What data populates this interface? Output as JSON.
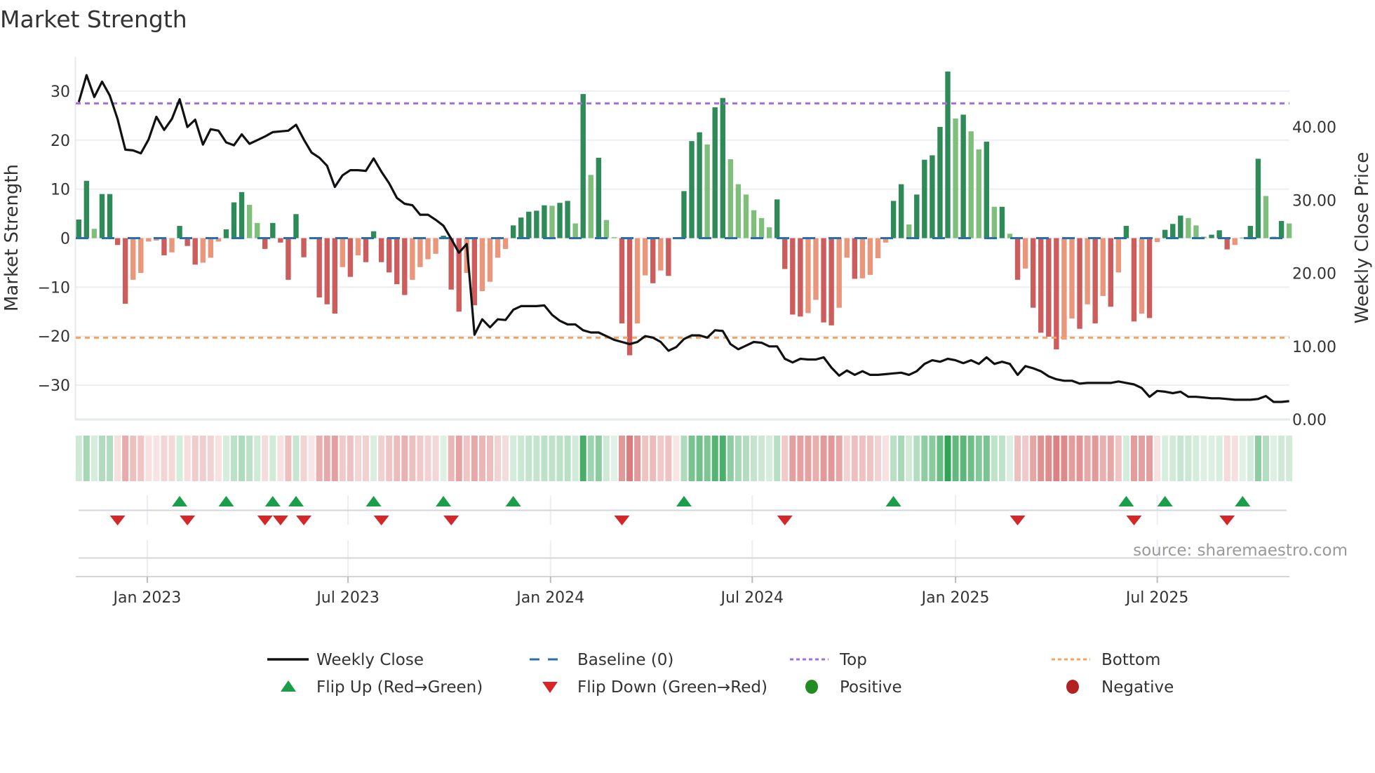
{
  "title": "Market Strength",
  "source": "source: sharemaestro.com",
  "colors": {
    "pos_up": "#2e8b57",
    "pos_down": "#7fbf7b",
    "neg_down": "#cd5c5c",
    "neg_up": "#e9967a",
    "price": "#111111",
    "baseline": "#2a6fa8",
    "top": "#a46ee0",
    "bottom": "#f4a460",
    "flip_up": "#1a9e4a",
    "flip_down": "#d62728",
    "heat_pos": "49,163,84",
    "heat_neg": "205,80,80",
    "legend_positive": "#228b22",
    "legend_negative": "#b22222"
  },
  "legend": {
    "weekly_close": "Weekly Close",
    "baseline": "Baseline (0)",
    "top": "Top",
    "bottom": "Bottom",
    "flip_up": "Flip Up (Red→Green)",
    "flip_down": "Flip Down (Green→Red)",
    "positive": "Positive",
    "negative": "Negative"
  },
  "chart_data": {
    "type": "bar",
    "title": "Market Strength",
    "ylabel": "Market Strength",
    "y2label": "Weekly Close Price",
    "ylim": [
      -37,
      37
    ],
    "y2lim": [
      0,
      49.6
    ],
    "yticks": [
      30,
      20,
      10,
      0,
      -10,
      -20,
      -30
    ],
    "y2ticks": [
      0,
      10,
      20,
      30,
      40
    ],
    "xlabel": "",
    "x_unit": "week index",
    "x_ticks": [
      {
        "label": "Jan 2023",
        "week": 8.83
      },
      {
        "label": "Jul 2023",
        "week": 34.7
      },
      {
        "label": "Jan 2024",
        "week": 60.8
      },
      {
        "label": "Jul 2024",
        "week": 86.8
      },
      {
        "label": "Jan 2025",
        "week": 113.0
      },
      {
        "label": "Jul 2025",
        "week": 139.0
      }
    ],
    "thresholds": {
      "top": 27.5,
      "bottom": -20.3,
      "baseline": 0
    },
    "grid": true,
    "legend_position": "bottom",
    "strength": [
      3.8,
      11.7,
      1.9,
      9.0,
      9.0,
      -1.4,
      -13.4,
      -8.5,
      -7.1,
      -0.7,
      -0.5,
      -3.5,
      -2.9,
      2.5,
      -1.6,
      -5.4,
      -5.0,
      -4.0,
      -0.7,
      1.8,
      7.3,
      9.4,
      6.8,
      3.1,
      -2.2,
      3.1,
      -0.9,
      -8.5,
      4.9,
      -3.9,
      0,
      -12.1,
      -13.5,
      -15.4,
      -5.9,
      -7.9,
      -3.5,
      -4.9,
      1.4,
      -4.9,
      -7.0,
      -9.4,
      -11.6,
      -8.5,
      -5.9,
      -4.3,
      -3.2,
      0.5,
      -10.5,
      -15.0,
      -7.1,
      -13.7,
      -10.8,
      -8.9,
      -4.0,
      -2.2,
      2.6,
      4.2,
      5.4,
      5.6,
      6.7,
      6.6,
      7.2,
      7.6,
      3.0,
      29.4,
      12.9,
      16.4,
      3.7,
      0.2,
      -17.4,
      -23.9,
      -17.4,
      -7.6,
      -9.2,
      -6.6,
      -7.7,
      0,
      9.6,
      19.8,
      21.6,
      19.1,
      26.7,
      28.6,
      16.1,
      11.0,
      8.9,
      5.7,
      4.1,
      2.2,
      7.9,
      -6.3,
      -15.6,
      -16.0,
      -15.3,
      -12.6,
      -17.2,
      -17.8,
      -14.2,
      -4.0,
      -8.3,
      -8.2,
      -7.5,
      -4.1,
      -0.9,
      7.6,
      11.0,
      2.8,
      8.9,
      16.0,
      16.9,
      22.7,
      34.0,
      24.4,
      25.2,
      21.8,
      18.1,
      19.7,
      6.4,
      6.4,
      0.9,
      -8.5,
      -6.2,
      -14.2,
      -19.3,
      -20.1,
      -22.7,
      -20.7,
      -16.4,
      -18.5,
      -13.5,
      -17.4,
      -11.8,
      -14.0,
      -7.0,
      2.5,
      -17.0,
      -15.4,
      -16.3,
      -0.8,
      1.7,
      2.9,
      4.6,
      4.1,
      2.6,
      0.3,
      0.7,
      1.6,
      -2.3,
      -1.4,
      0.1,
      2.5,
      16.2,
      8.6,
      0.3,
      3.5,
      3.0
    ],
    "weekly_close": [
      43.4,
      47.1,
      44.1,
      46.2,
      44.3,
      41.1,
      36.9,
      36.8,
      36.4,
      38.3,
      41.4,
      39.6,
      41.1,
      43.8,
      40.0,
      41.0,
      37.6,
      39.7,
      39.5,
      37.9,
      37.5,
      39.0,
      37.7,
      38.2,
      38.7,
      39.3,
      39.4,
      39.5,
      40.3,
      38.3,
      36.5,
      35.8,
      34.7,
      31.8,
      33.4,
      34.1,
      34.1,
      34.0,
      35.7,
      33.9,
      32.3,
      30.3,
      29.5,
      29.3,
      28.0,
      28.0,
      27.3,
      26.5,
      24.7,
      22.8,
      24.0,
      11.6,
      13.7,
      12.6,
      13.7,
      13.6,
      15.0,
      15.5,
      15.5,
      15.5,
      15.6,
      14.3,
      13.5,
      13.0,
      13.0,
      12.2,
      11.9,
      11.9,
      11.4,
      10.9,
      10.6,
      10.3,
      10.6,
      11.4,
      11.2,
      10.6,
      9.4,
      9.9,
      11.0,
      11.5,
      11.5,
      11.2,
      12.2,
      12.1,
      10.3,
      9.6,
      10.1,
      10.6,
      10.5,
      10.0,
      10.0,
      8.3,
      7.8,
      8.3,
      8.2,
      8.2,
      8.5,
      7.1,
      6.0,
      6.7,
      6.1,
      6.6,
      6.1,
      6.1,
      6.2,
      6.3,
      6.4,
      6.1,
      6.6,
      7.6,
      8.1,
      7.9,
      8.3,
      8.1,
      7.7,
      8.1,
      7.6,
      8.5,
      7.6,
      7.9,
      7.6,
      6.1,
      7.3,
      7.0,
      6.6,
      5.9,
      5.5,
      5.3,
      5.3,
      4.9,
      5.0,
      5.0,
      5.0,
      5.0,
      5.2,
      5.0,
      4.8,
      4.3,
      3.1,
      3.9,
      3.8,
      3.6,
      3.8,
      3.1,
      3.1,
      3.0,
      2.9,
      2.9,
      2.8,
      2.7,
      2.7,
      2.7,
      2.8,
      3.2,
      2.4,
      2.4,
      2.5
    ]
  }
}
